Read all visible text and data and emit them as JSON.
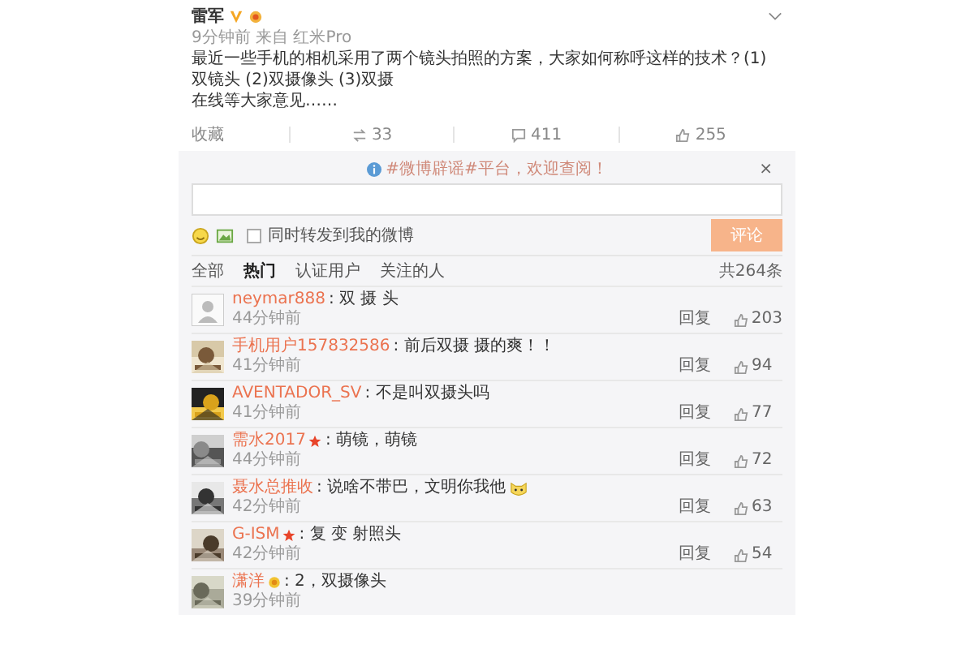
{
  "post": {
    "author": "雷军",
    "verified": true,
    "meta": "9分钟前 来自 红米Pro",
    "content": [
      "最近一些手机的相机采用了两个镜头拍照的方案，大家如何称呼这样的技术？(1)",
      "双镜头 (2)双摄像头 (3)双摄",
      "在线等大家意见……"
    ],
    "actions": {
      "favorite": "收藏",
      "reposts": "33",
      "comments": "411",
      "likes": "255"
    }
  },
  "notice": {
    "text": "#微博辟谣#平台，欢迎查阅！",
    "close": "×"
  },
  "compose": {
    "repost_label": "同时转发到我的微博",
    "repost_checked": false,
    "submit": "评论"
  },
  "tabs": [
    {
      "label": "全部",
      "selected": false
    },
    {
      "label": "热门",
      "selected": true
    },
    {
      "label": "认证用户",
      "selected": false
    },
    {
      "label": "关注的人",
      "selected": false
    }
  ],
  "total": "共264条",
  "comments": [
    {
      "user": "neymar888",
      "kind": "plain",
      "text": ": 双 摄 头",
      "emoji": false,
      "time": "44分钟前",
      "reply": "回复",
      "likes": "203"
    },
    {
      "user": "手机用户157832586",
      "kind": "plain",
      "text": ": 前后双摄 摄的爽！！",
      "emoji": false,
      "time": "41分钟前",
      "reply": "回复",
      "likes": "94"
    },
    {
      "user": "AVENTADOR_SV",
      "kind": "plain",
      "text": ": 不是叫双摄头吗",
      "emoji": false,
      "time": "41分钟前",
      "reply": "回复",
      "likes": "77"
    },
    {
      "user": "需水2017",
      "kind": "star",
      "text": ": 萌镜，萌镜",
      "emoji": false,
      "time": "44分钟前",
      "reply": "回复",
      "likes": "72"
    },
    {
      "user": "聂水总推收",
      "kind": "plain",
      "text": ": 说啥不带巴，文明你我他",
      "emoji": true,
      "time": "42分钟前",
      "reply": "回复",
      "likes": "63"
    },
    {
      "user": "G-ISM",
      "kind": "star",
      "text": ": 复 变 射照头",
      "emoji": false,
      "time": "42分钟前",
      "reply": "回复",
      "likes": "54"
    },
    {
      "user": "潇洋",
      "kind": "medal",
      "text": ": 2，双摄像头",
      "emoji": false,
      "time": "39分钟前"
    }
  ]
}
